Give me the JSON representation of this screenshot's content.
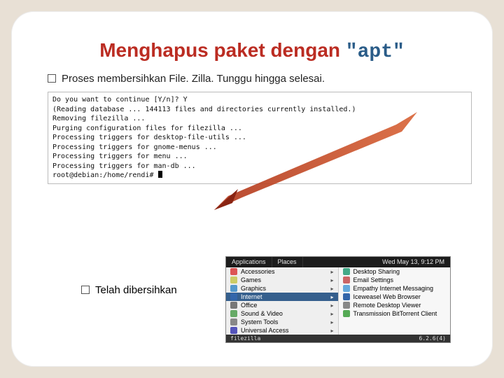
{
  "title": {
    "part1": "Menghapus paket dengan ",
    "part2": "\"apt\""
  },
  "bullet1": "Proses membersihkan File. Zilla. Tunggu hingga selesai.",
  "terminal": {
    "l1": "Do you want to continue [Y/n]? Y",
    "l2": "(Reading database ... 144113 files and directories currently installed.)",
    "l3": "Removing filezilla ...",
    "l4": "Purging configuration files for filezilla ...",
    "l5": "Processing triggers for desktop-file-utils ...",
    "l6": "Processing triggers for gnome-menus ...",
    "l7": "Processing triggers for menu ...",
    "l8": "Processing triggers for man-db ...",
    "l9": "root@debian:/home/rendi# "
  },
  "bullet2": "Telah dibersihkan",
  "panel": {
    "apps": "Applications",
    "places": "Places",
    "clock": "Wed May 13, 9:12 PM"
  },
  "menuLeft": [
    {
      "label": "Accessories",
      "color": "#d55"
    },
    {
      "label": "Games",
      "color": "#cc6"
    },
    {
      "label": "Graphics",
      "color": "#59c"
    },
    {
      "label": "Internet",
      "color": "#36a",
      "selected": true
    },
    {
      "label": "Office",
      "color": "#777"
    },
    {
      "label": "Sound & Video",
      "color": "#6a6"
    },
    {
      "label": "System Tools",
      "color": "#888"
    },
    {
      "label": "Universal Access",
      "color": "#55b"
    }
  ],
  "menuRight": [
    {
      "label": "Desktop Sharing",
      "color": "#4a8"
    },
    {
      "label": "Email Settings",
      "color": "#c66"
    },
    {
      "label": "Empathy Internet Messaging",
      "color": "#6ad"
    },
    {
      "label": "Iceweasel Web Browser",
      "color": "#36a"
    },
    {
      "label": "Remote Desktop Viewer",
      "color": "#888"
    },
    {
      "label": "Transmission BitTorrent Client",
      "color": "#5a5"
    }
  ],
  "below": {
    "left": "filezilla",
    "right": "6.2.6(4)"
  }
}
